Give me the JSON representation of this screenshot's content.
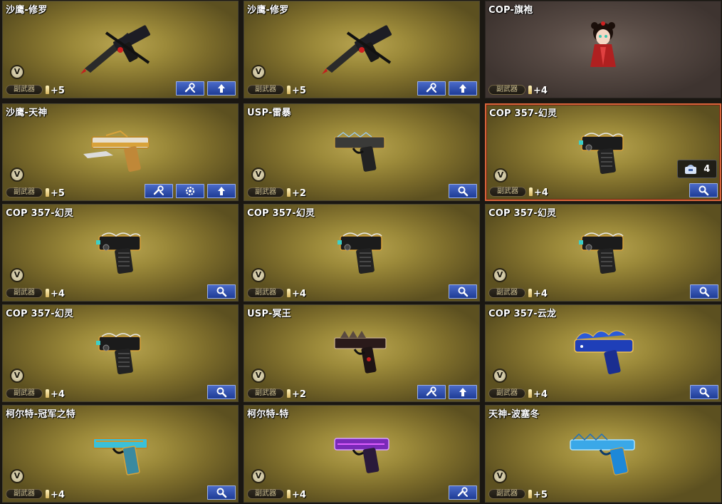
{
  "labels": {
    "type": "副武器"
  },
  "cards": [
    {
      "title": "沙鹰-修罗",
      "level": "+5",
      "weapon": "blade-pistol",
      "buttons": [
        "tune",
        "upgrade"
      ]
    },
    {
      "title": "沙鹰-修罗",
      "level": "+5",
      "weapon": "blade-pistol",
      "buttons": [
        "tune",
        "upgrade"
      ]
    },
    {
      "title": "COP-旗袍",
      "level": "+4",
      "weapon": "character",
      "buttons": [],
      "theme": "brown"
    },
    {
      "title": "沙鹰-天神",
      "level": "+5",
      "weapon": "gold-pistol",
      "buttons": [
        "tune",
        "gear",
        "upgrade"
      ]
    },
    {
      "title": "USP-雷暴",
      "level": "+2",
      "weapon": "usp",
      "buttons": [
        "inspect"
      ]
    },
    {
      "title": "COP 357-幻灵",
      "level": "+4",
      "weapon": "cop",
      "buttons": [
        "inspect"
      ],
      "selected": true,
      "inventory_count": "4"
    },
    {
      "title": "COP 357-幻灵",
      "level": "+4",
      "weapon": "cop",
      "buttons": [
        "inspect"
      ]
    },
    {
      "title": "COP 357-幻灵",
      "level": "+4",
      "weapon": "cop",
      "buttons": [
        "inspect"
      ]
    },
    {
      "title": "COP 357-幻灵",
      "level": "+4",
      "weapon": "cop",
      "buttons": [
        "inspect"
      ]
    },
    {
      "title": "COP 357-幻灵",
      "level": "+4",
      "weapon": "cop",
      "buttons": [
        "inspect"
      ]
    },
    {
      "title": "USP-冥王",
      "level": "+2",
      "weapon": "usp-dark",
      "buttons": [
        "tune",
        "upgrade"
      ]
    },
    {
      "title": "COP 357-云龙",
      "level": "+4",
      "weapon": "blue-dragon",
      "buttons": [
        "inspect"
      ]
    },
    {
      "title": "柯尔特-冠军之特",
      "level": "+4",
      "weapon": "colt-teal",
      "buttons": [
        "inspect"
      ]
    },
    {
      "title": "柯尔特-特",
      "level": "+4",
      "weapon": "colt-purple",
      "buttons": [
        "tune"
      ]
    },
    {
      "title": "天神-波塞冬",
      "level": "+5",
      "weapon": "blue-pistol",
      "buttons": []
    }
  ],
  "colors": {
    "gold_panel": "#9c8a3a",
    "button_blue": "#2a4aa8",
    "selected_border": "#d8643a"
  }
}
